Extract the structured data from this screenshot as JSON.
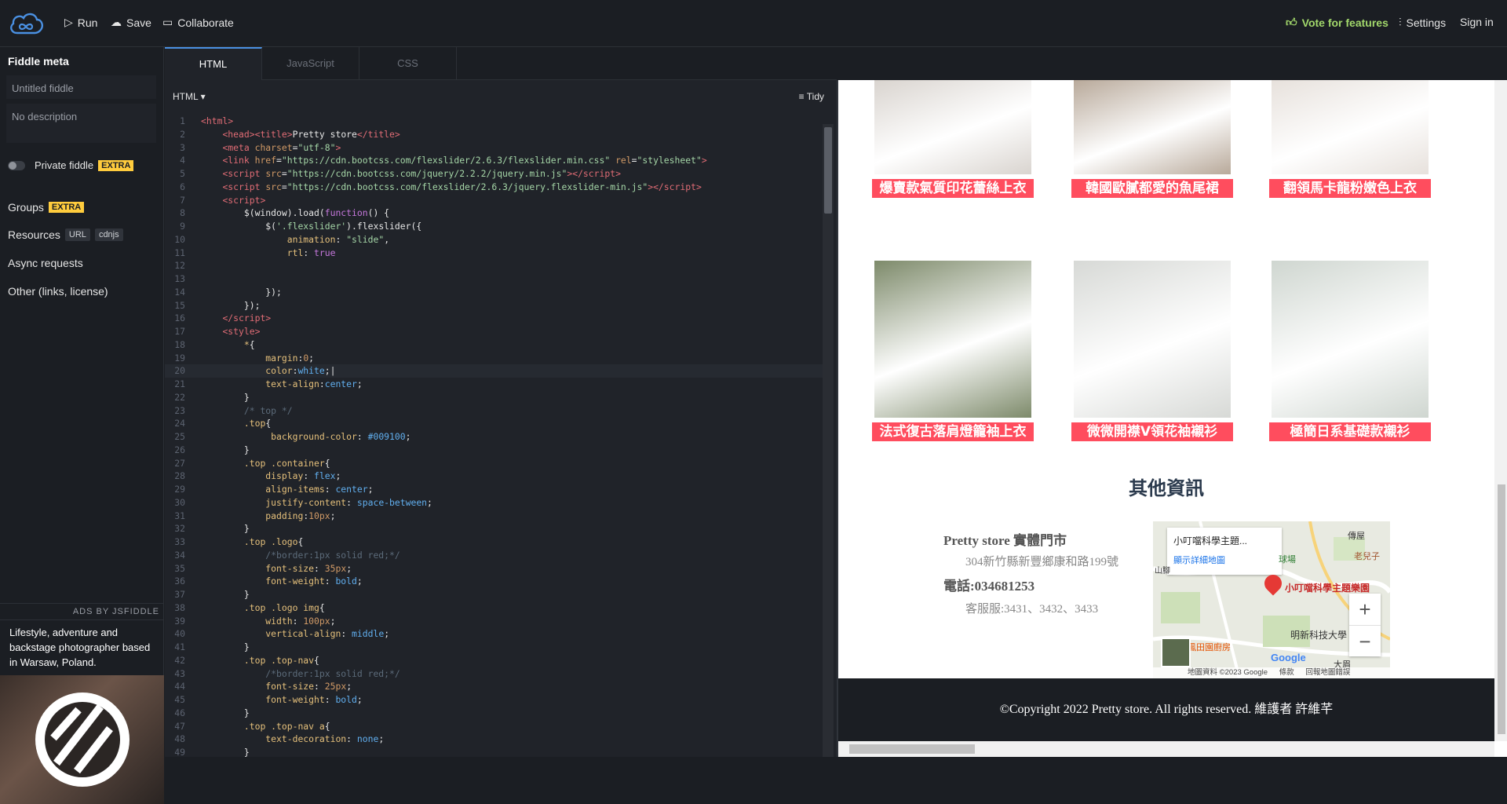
{
  "topbar": {
    "run": "Run",
    "save": "Save",
    "collaborate": "Collaborate",
    "vote": "Vote for features",
    "settings": "Settings",
    "signin": "Sign in",
    "accent_color": "#a2d86b"
  },
  "sidebar": {
    "title": "Fiddle meta",
    "name_placeholder": "Untitled fiddle",
    "desc_placeholder": "No description",
    "private_label": "Private fiddle",
    "extra_badge": "EXTRA",
    "groups": "Groups",
    "resources": "Resources",
    "resource_chips": [
      "URL",
      "cdnjs"
    ],
    "async": "Async requests",
    "other": "Other (links, license)",
    "ads_label": "ADS BY JSFIDDLE",
    "ad_text": "Lifestyle, adventure and backstage photographer based in Warsaw, Poland."
  },
  "editor": {
    "tabs": [
      "HTML",
      "JavaScript",
      "CSS"
    ],
    "active_tab": "HTML",
    "lang": "HTML",
    "tidy": "Tidy",
    "current_line": 20
  },
  "result": {
    "products": [
      {
        "label": "爆賣款氣質印花蕾絲上衣",
        "color": "#d9d4cf"
      },
      {
        "label": "韓國歐膩都愛的魚尾裙",
        "color": "#b8a99a"
      },
      {
        "label": "翻領馬卡龍粉嫩色上衣",
        "color": "#e7e1dc"
      },
      {
        "label": "法式復古落肩燈籠袖上衣",
        "color": "#7d8a6a"
      },
      {
        "label": "微微開襟V領花袖襯衫",
        "color": "#d7d9d6"
      },
      {
        "label": "極簡日系基礎款襯衫",
        "color": "#cfd6d0"
      }
    ],
    "other_title": "其他資訊",
    "store_name": "Pretty store 實體門市",
    "address": "304新竹縣新豐鄉康和路199號",
    "phone": "電話:034681253",
    "service": "客服服:3431、3432、3433",
    "map": {
      "place": "小叮噹科學主題...",
      "link": "顯示詳細地圖",
      "pin_label": "小叮噹科學主題樂園",
      "labels": [
        "傳屋",
        "老兒子",
        "球場",
        "明新科技大學",
        "鳳田園廚房",
        "大眉",
        "山腳",
        "Google"
      ],
      "attribution": "地圖資料 ©2023 Google",
      "terms": "條款",
      "report": "回報地圖錯誤",
      "zoom_in": "+",
      "zoom_out": "−"
    },
    "footer": "©Copyright 2022 Pretty store. All rights reserved. 維護者 許維芊"
  }
}
